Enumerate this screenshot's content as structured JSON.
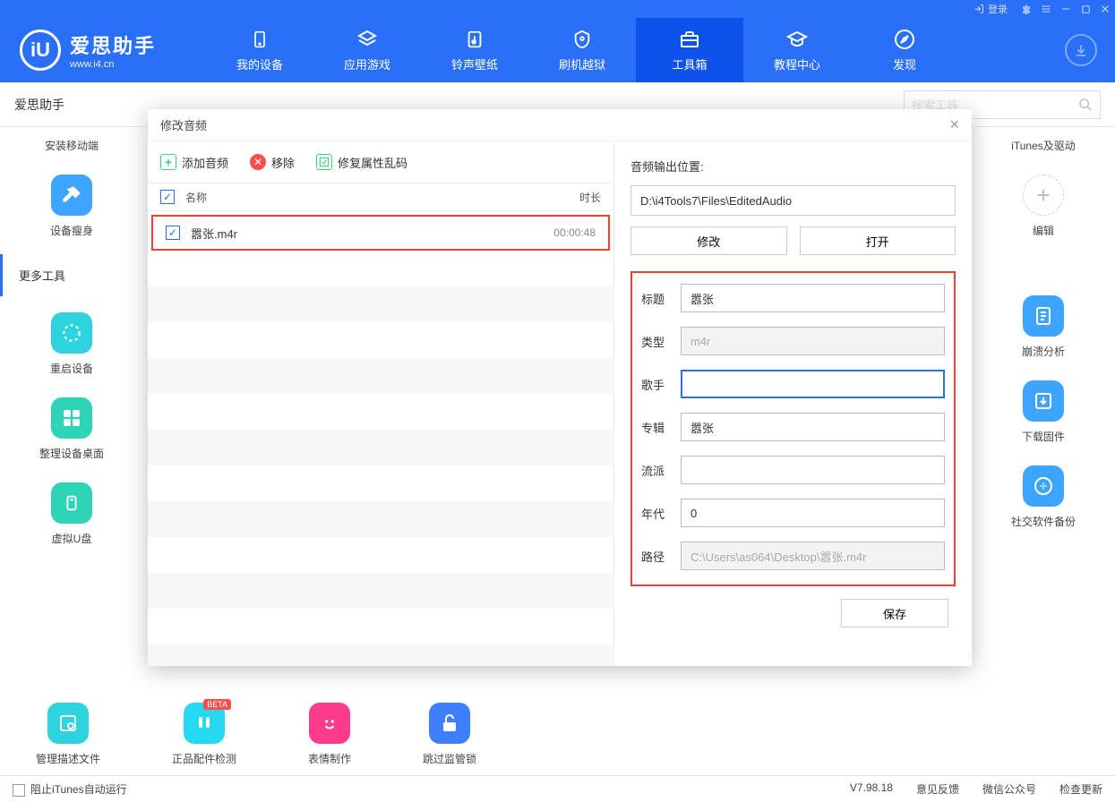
{
  "titlebar": {
    "login": "登录"
  },
  "brand": {
    "name": "爱思助手",
    "url": "www.i4.cn"
  },
  "nav": {
    "items": [
      {
        "label": "我的设备"
      },
      {
        "label": "应用游戏"
      },
      {
        "label": "铃声壁纸"
      },
      {
        "label": "刷机越狱"
      },
      {
        "label": "工具箱"
      },
      {
        "label": "教程中心"
      },
      {
        "label": "发现"
      }
    ]
  },
  "subbar": {
    "title": "爱思助手",
    "search_placeholder": "搜索工具"
  },
  "sidebar": {
    "install_label": "安装移动端",
    "slim_label": "设备瘦身",
    "more_tools": "更多工具",
    "reboot_label": "重启设备",
    "arrange_label": "整理设备桌面",
    "udisk_label": "虚拟U盘",
    "profile_label": "管理描述文件"
  },
  "rightcol": {
    "itunes_label": "iTunes及驱动",
    "edit_label": "编辑",
    "crash_label": "崩溃分析",
    "firmware_label": "下载固件",
    "social_label": "社交软件备份"
  },
  "toolrow": {
    "accessory_label": "正品配件检测",
    "emoji_label": "表情制作",
    "lock_label": "跳过监管锁",
    "beta": "BETA"
  },
  "modal": {
    "title": "修改音频",
    "toolbar": {
      "add": "添加音频",
      "remove": "移除",
      "fix": "修复属性乱码"
    },
    "header": {
      "check": "✓",
      "name": "名称",
      "duration": "时长"
    },
    "row": {
      "name": "嚣张.m4r",
      "duration": "00:00:48"
    },
    "output_label": "音频输出位置:",
    "output_path": "D:\\i4Tools7\\Files\\EditedAudio",
    "btn_modify": "修改",
    "btn_open": "打开",
    "form": {
      "title_label": "标题",
      "title_value": "嚣张",
      "type_label": "类型",
      "type_value": "m4r",
      "singer_label": "歌手",
      "singer_value": "",
      "album_label": "专辑",
      "album_value": "嚣张",
      "genre_label": "流派",
      "genre_value": "",
      "year_label": "年代",
      "year_value": "0",
      "path_label": "路径",
      "path_value": "C:\\Users\\as064\\Desktop\\嚣张.m4r"
    },
    "save": "保存"
  },
  "status": {
    "block_itunes": "阻止iTunes自动运行",
    "version": "V7.98.18",
    "feedback": "意见反馈",
    "wechat": "微信公众号",
    "check_update": "检查更新"
  }
}
